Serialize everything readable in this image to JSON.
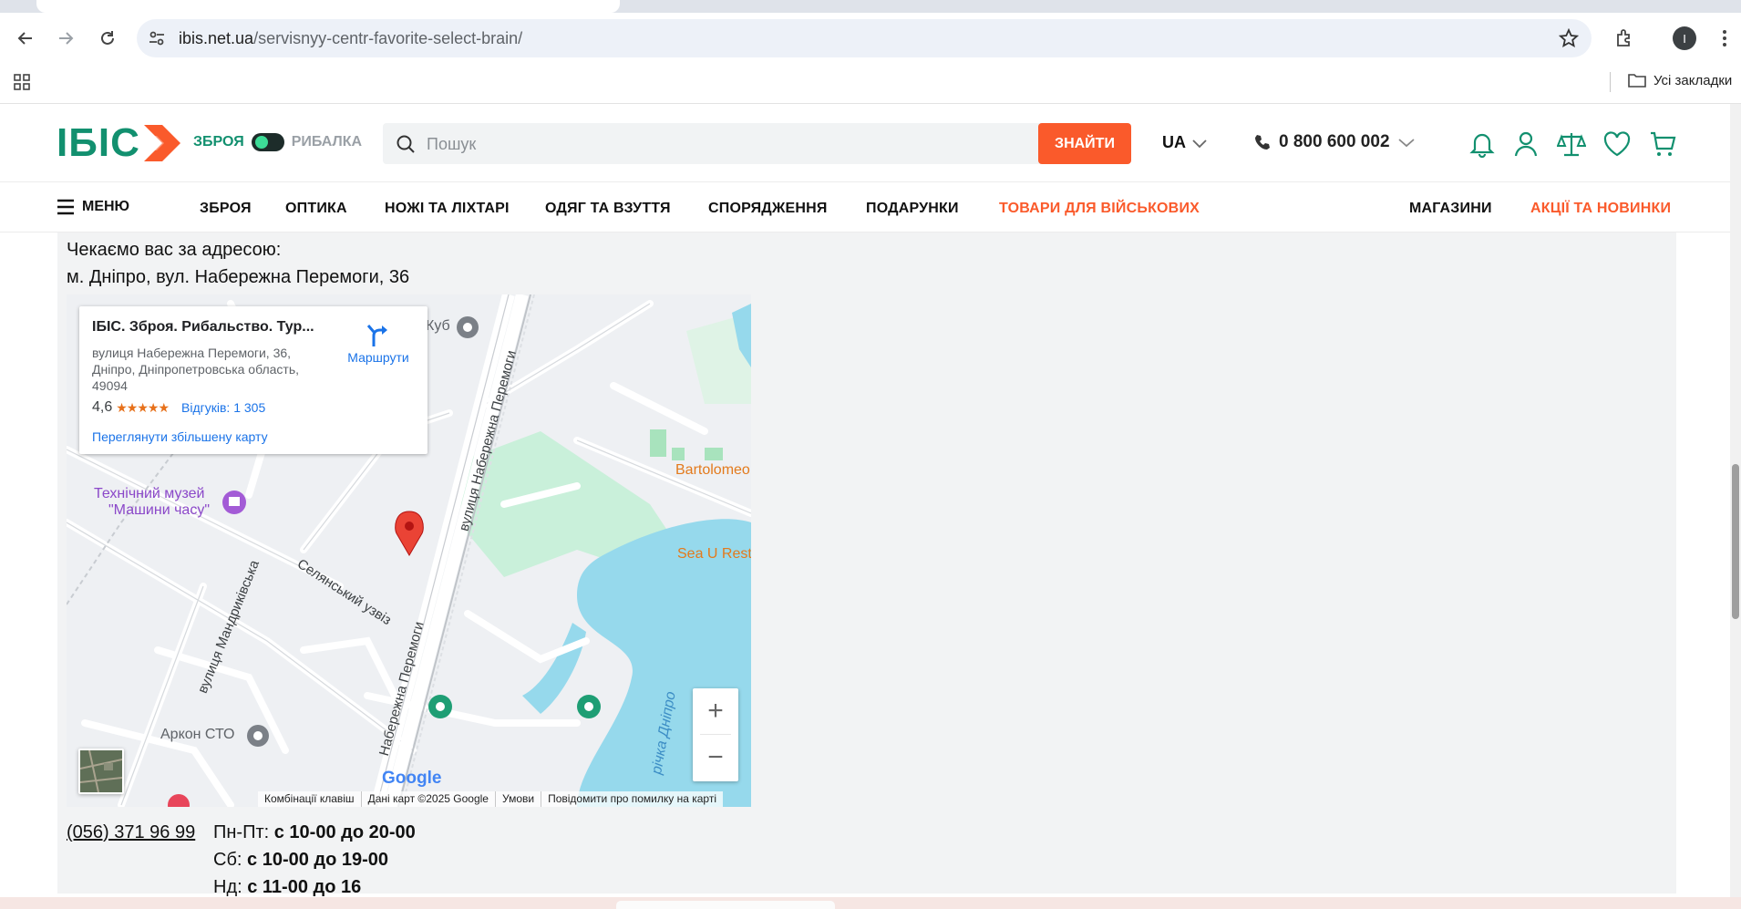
{
  "browser": {
    "url_host": "ibis.net.ua",
    "url_path": "/servisnyy-centr-favorite-select-brain/",
    "profile_initial": "I",
    "bookmarks_all_label": "Усі закладки"
  },
  "header": {
    "logo_text": "ІБІС",
    "toggle_left": "ЗБРОЯ",
    "toggle_right": "РИБАЛКА",
    "search_placeholder": "Пошук",
    "search_button": "ЗНАЙТИ",
    "lang": "UA",
    "phone": "0 800 600 002"
  },
  "nav": {
    "menu_label": "МЕНЮ",
    "items": [
      "ЗБРОЯ",
      "ОПТИКА",
      "НОЖІ ТА ЛІХТАРІ",
      "ОДЯГ ТА ВЗУТТЯ",
      "СПОРЯДЖЕННЯ",
      "ПОДАРУНКИ",
      "ТОВАРИ ДЛЯ ВІЙСЬКОВИХ"
    ],
    "stores": "МАГАЗИНИ",
    "promo": "АКЦІЇ ТА НОВИНКИ"
  },
  "content": {
    "address_intro": "Чекаємо вас за адресою:",
    "address": "м. Дніпро, вул. Набережна Перемоги, 36",
    "phone": "(056) 371 96 99",
    "hours": [
      {
        "label": "Пн-Пт: ",
        "value": "с 10-00 до 20-00"
      },
      {
        "label": "Сб: ",
        "value": "с 10-00 до 19-00"
      },
      {
        "label": "Нд: ",
        "value": "с 11-00 до 16"
      }
    ]
  },
  "map": {
    "card_title": "ІБІС. Зброя. Рибальство. Тур...",
    "card_address": "вулиця Набережна Перемоги, 36, Дніпро, Дніпропетровська область, 49094",
    "rating": "4,6",
    "stars": "★★★★★",
    "reviews": "Відгуків: 1 305",
    "larger_map": "Переглянути збільшену карту",
    "directions": "Маршрути",
    "labels": {
      "museum_1": "Технічний музей",
      "museum_2": "\"Машини часу\"",
      "bartolomeo": "Bartolomeo",
      "sea_u": "Sea U Rest",
      "kub": "Куб",
      "arkon": "Аркон СТО",
      "street_main_1": "вулиця Набережна Перемоги",
      "street_main_2": "Набережна Перемоги",
      "street_selianskyi": "Селянський узвіз",
      "street_mandrykivska": "вулиця Мандриківська",
      "river": "річка Дніпро"
    },
    "google_logo": "Google",
    "attribution": [
      "Комбінації клавіш",
      "Дані карт ©2025 Google",
      "Умови",
      "Повідомити про помилку на карті"
    ],
    "zoom_in": "+",
    "zoom_out": "−"
  },
  "colors": {
    "brand_green": "#12906f",
    "accent_orange": "#fa5a2b",
    "water": "#96d9ec",
    "park": "#c9f0da"
  }
}
